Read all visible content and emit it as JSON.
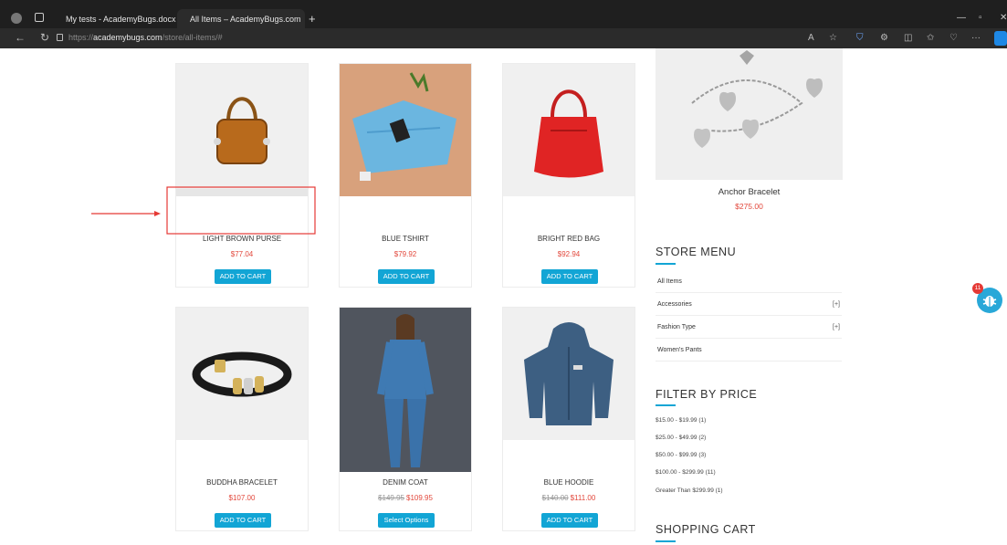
{
  "browser": {
    "tabs": [
      {
        "label": "My tests - AcademyBugs.docx - ",
        "close": "×"
      },
      {
        "label": "All Items – AcademyBugs.com",
        "close": "×"
      }
    ],
    "new_tab": "+",
    "url_prefix": "https://",
    "url_host": "academybugs.com",
    "url_path": "/store/all-items/#"
  },
  "products": [
    {
      "name": "LIGHT BROWN PURSE",
      "price": "$77.04",
      "old_price": "",
      "button": "ADD TO CART"
    },
    {
      "name": "BLUE TSHIRT",
      "price": "$79.92",
      "old_price": "",
      "button": "ADD TO CART"
    },
    {
      "name": "BRIGHT RED BAG",
      "price": "$92.94",
      "old_price": "",
      "button": "ADD TO CART"
    },
    {
      "name": "BUDDHA BRACELET",
      "price": "$107.00",
      "old_price": "",
      "button": "ADD TO CART"
    },
    {
      "name": "DENIM COAT",
      "price": "$109.95",
      "old_price": "$149.95",
      "button": "Select Options"
    },
    {
      "name": "BLUE HOODIE",
      "price": "$111.00",
      "old_price": "$140.00",
      "button": "ADD TO CART"
    }
  ],
  "featured": {
    "name": "Anchor Bracelet",
    "price": "$275.00"
  },
  "store_menu": {
    "title": "STORE MENU",
    "items": [
      {
        "label": "All Items",
        "expand": ""
      },
      {
        "label": "Accessories",
        "expand": "[+]"
      },
      {
        "label": "Fashion Type",
        "expand": "[+]"
      },
      {
        "label": "Women's Pants",
        "expand": ""
      }
    ]
  },
  "filter_by_price": {
    "title": "FILTER BY PRICE",
    "ranges": [
      "$15.00 - $19.99 (1)",
      "$25.00 - $49.99 (2)",
      "$50.00 - $99.99 (3)",
      "$100.00 - $299.99 (11)",
      "Greater Than $299.99 (1)"
    ]
  },
  "shopping_cart": {
    "title": "SHOPPING CART"
  },
  "bug_widget": {
    "count": "11"
  },
  "colors": {
    "accent": "#12a5d5",
    "price": "#e2473b",
    "annotation": "#e53935"
  }
}
